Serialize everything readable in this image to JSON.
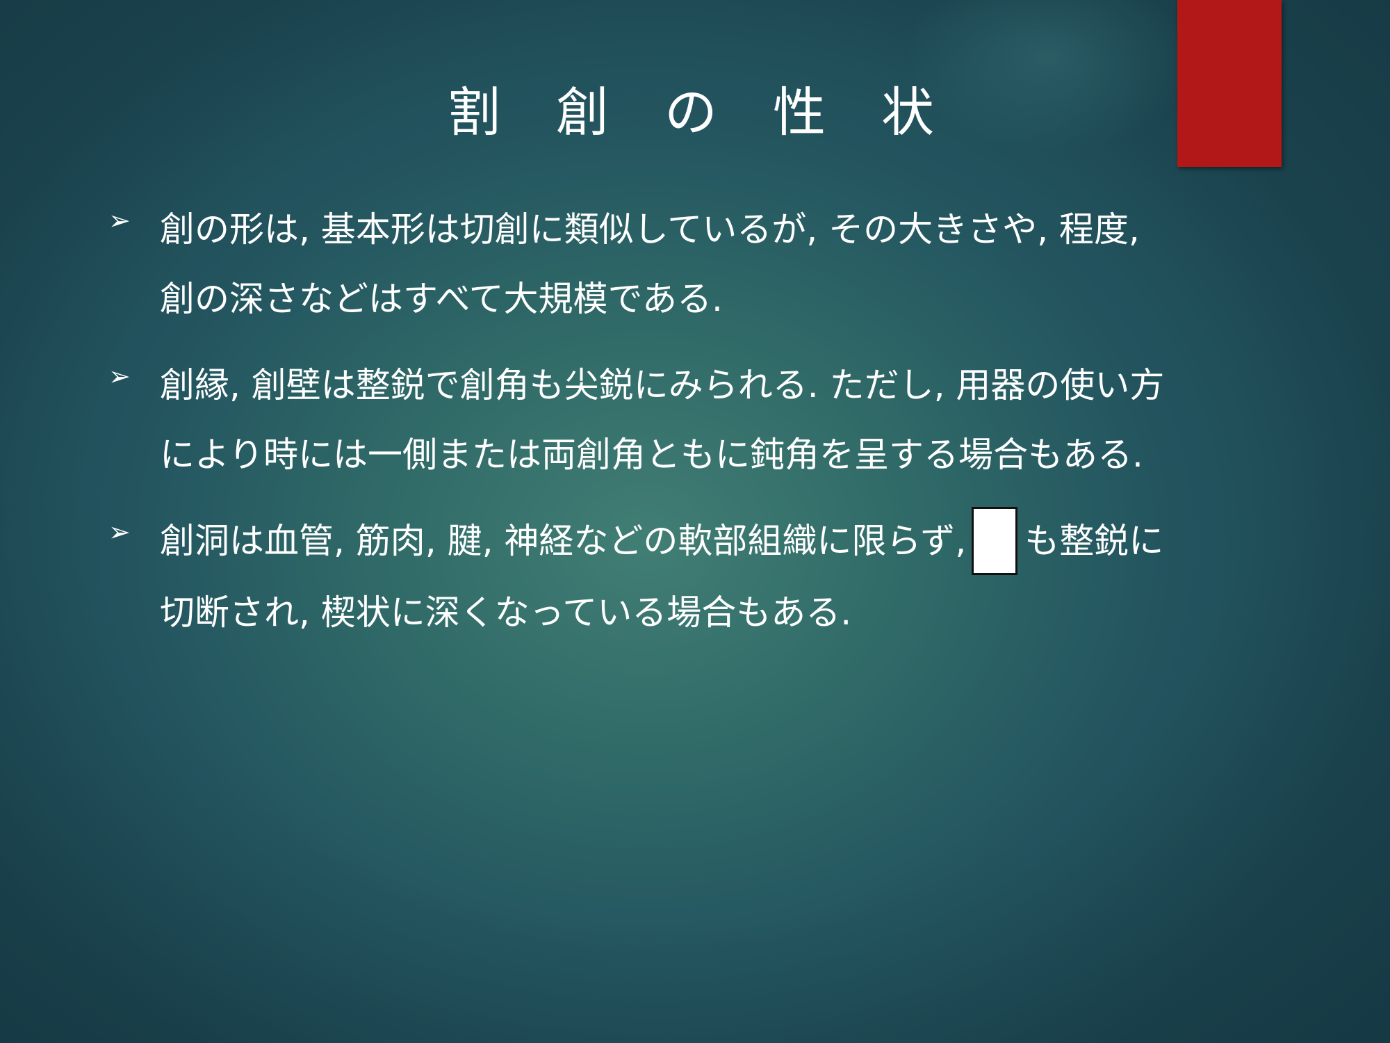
{
  "slide": {
    "accent_color": "#b21818",
    "title": "割　創　の　性　状",
    "bullet_icon": "arrow-bullet-icon",
    "bullets": [
      {
        "line1": "創の形は, 基本形は切創に類似しているが, その大きさや, 程度,",
        "line2": "創の深さなどはすべて大規模である."
      },
      {
        "line1": "創縁, 創壁は整鋭で創角も尖鋭にみられる. ただし, 用器の使い方",
        "line2": "により時には一側または両創角ともに鈍角を呈する場合もある."
      },
      {
        "line1_before": "創洞は血管, 筋肉, 腱, 神経などの軟部組織に限らず,",
        "line1_after": "も整鋭に",
        "line2": "切断され, 楔状に深くなっている場合もある."
      }
    ]
  }
}
